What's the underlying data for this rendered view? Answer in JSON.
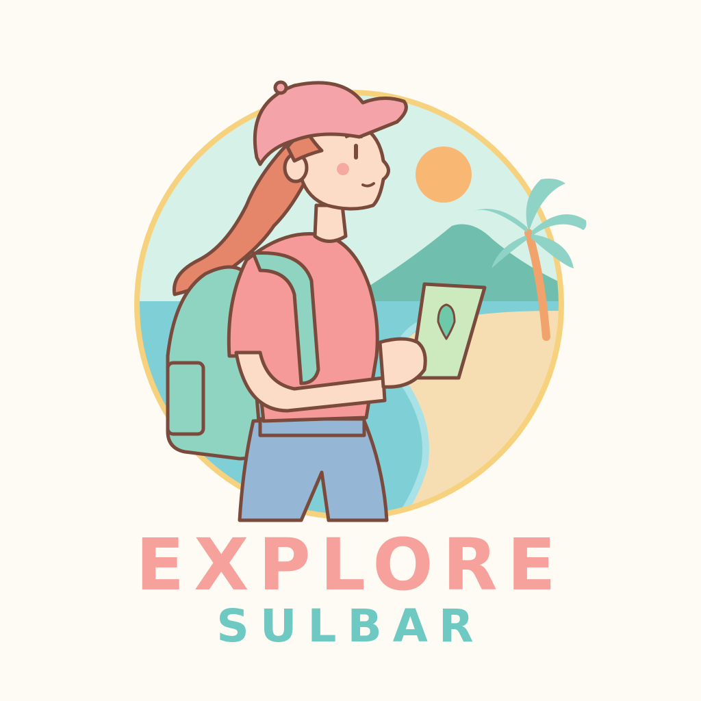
{
  "logo": {
    "title": "EXPLORE",
    "subtitle": "SULBAR"
  },
  "colors": {
    "background": "#fdfbf3",
    "title_pink": "#f6a19b",
    "subtitle_teal": "#6ec9c2",
    "ring_yellow": "#f7d27e",
    "sky": "#d6f1e8",
    "sun": "#f8b873",
    "mountain": "#70bfae",
    "sea": "#7fcfd6",
    "sand": "#f7ddb2",
    "palm_leaf": "#8fd3c6",
    "palm_trunk": "#f2a36b",
    "cap": "#f4a3a8",
    "hair": "#e5866a",
    "skin": "#fcdcc6",
    "shirt": "#f59a98",
    "backpack": "#8fd3c1",
    "jeans": "#96b6d6",
    "map": "#cdeabe",
    "outline": "#7a4a3c"
  },
  "icons": [
    "sun-icon",
    "palm-tree-icon",
    "map-pin-icon",
    "backpack-icon"
  ]
}
